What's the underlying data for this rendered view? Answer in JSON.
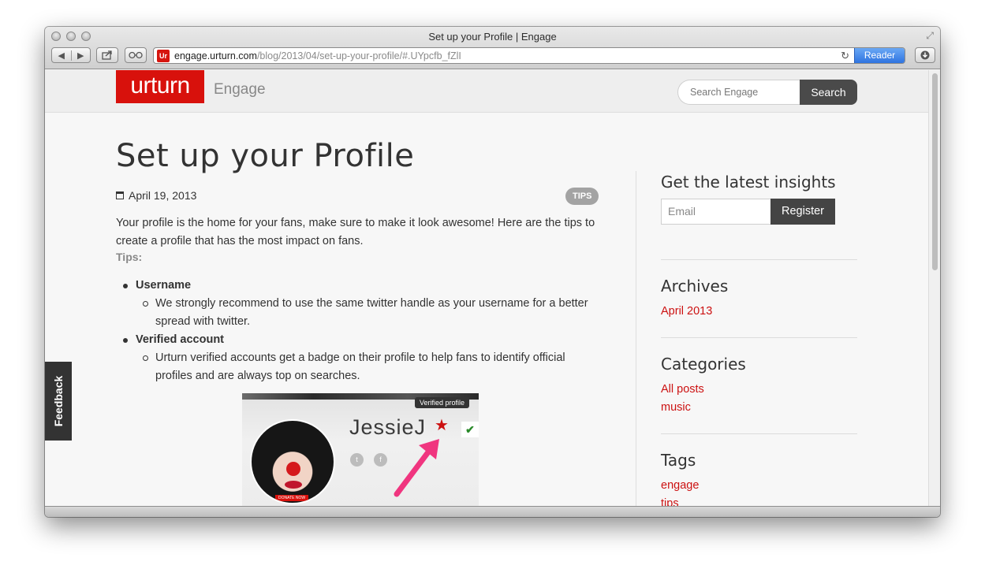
{
  "browser": {
    "window_title": "Set up your Profile | Engage",
    "url_domain": "engage.urturn.com",
    "url_path": "/blog/2013/04/set-up-your-profile/#.UYpcfb_fZlI",
    "reader_label": "Reader",
    "favicon_text": "Ur"
  },
  "header": {
    "logo_text": "urturn",
    "site_name": "Engage",
    "search_placeholder": "Search Engage",
    "search_button": "Search"
  },
  "post": {
    "title": "Set up your Profile",
    "date": "April 19, 2013",
    "tag": "TIPS",
    "intro": "Your profile is the home for your fans, make sure to make it look awesome! Here are the tips to create a profile that has the most impact on fans.",
    "tips_label": "Tips:",
    "tips": [
      {
        "heading": "Username",
        "detail": "We strongly recommend to use the same twitter handle as your username for a better spread with twitter."
      },
      {
        "heading": "Verified account",
        "detail": "Urturn verified accounts get a badge on their profile to help fans to identify official profiles and are always top on searches."
      }
    ],
    "image": {
      "tooltip": "Verified profile",
      "profile_name": "JessieJ",
      "donate_label": "DONATE NOW"
    }
  },
  "feedback": {
    "label": "Feedback"
  },
  "sidebar": {
    "newsletter_heading": "Get the latest insights",
    "email_placeholder": "Email",
    "register_button": "Register",
    "archives_heading": "Archives",
    "archives": [
      "April 2013"
    ],
    "categories_heading": "Categories",
    "categories": [
      "All posts",
      "music"
    ],
    "tags_heading": "Tags",
    "tags": [
      "engage",
      "tips"
    ]
  },
  "colors": {
    "brand_red": "#d8110c",
    "link_red": "#cc1111",
    "dark_button": "#444444"
  }
}
